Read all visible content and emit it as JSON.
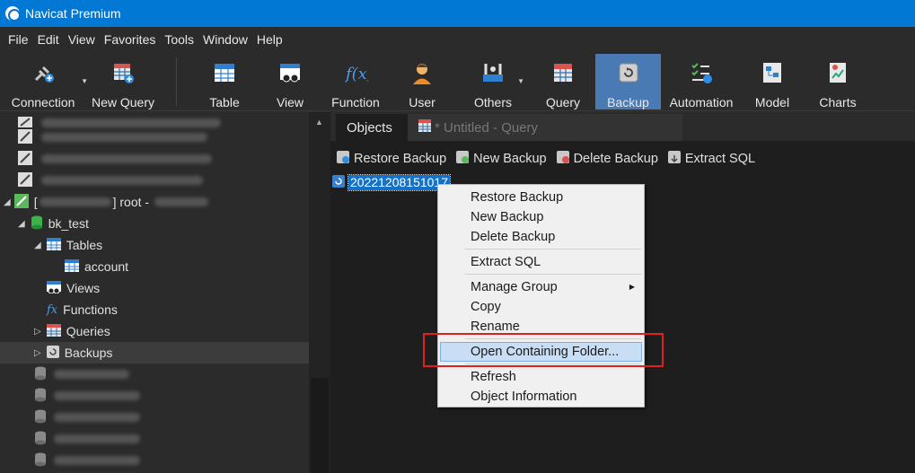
{
  "window": {
    "title": "Navicat Premium"
  },
  "menu": [
    "File",
    "Edit",
    "View",
    "Favorites",
    "Tools",
    "Window",
    "Help"
  ],
  "toolbar": {
    "connection": "Connection",
    "new_query": "New Query",
    "table": "Table",
    "view": "View",
    "function": "Function",
    "user": "User",
    "others": "Others",
    "query": "Query",
    "backup": "Backup",
    "automation": "Automation",
    "model": "Model",
    "charts": "Charts",
    "active": "Backup"
  },
  "sidebar": {
    "connection_label": "] root -",
    "database": "bk_test",
    "tables": "Tables",
    "table_account": "account",
    "views": "Views",
    "functions": "Functions",
    "queries": "Queries",
    "backups": "Backups"
  },
  "tabs": {
    "objects": "Objects",
    "query": "* Untitled - Query"
  },
  "objectbar": {
    "restore": "Restore Backup",
    "new": "New Backup",
    "delete": "Delete Backup",
    "extract": "Extract SQL"
  },
  "backup_item": "20221208151017",
  "context_menu": {
    "restore": "Restore Backup",
    "new": "New Backup",
    "delete": "Delete Backup",
    "extract": "Extract SQL",
    "manage_group": "Manage Group",
    "copy": "Copy",
    "rename": "Rename",
    "open_folder": "Open Containing Folder...",
    "refresh": "Refresh",
    "object_info": "Object Information"
  },
  "colors": {
    "titlebar": "#0078d4",
    "active_tool": "#4a7ab4",
    "highlight_box": "#e0201c",
    "menu_hover": "#c9def5"
  }
}
